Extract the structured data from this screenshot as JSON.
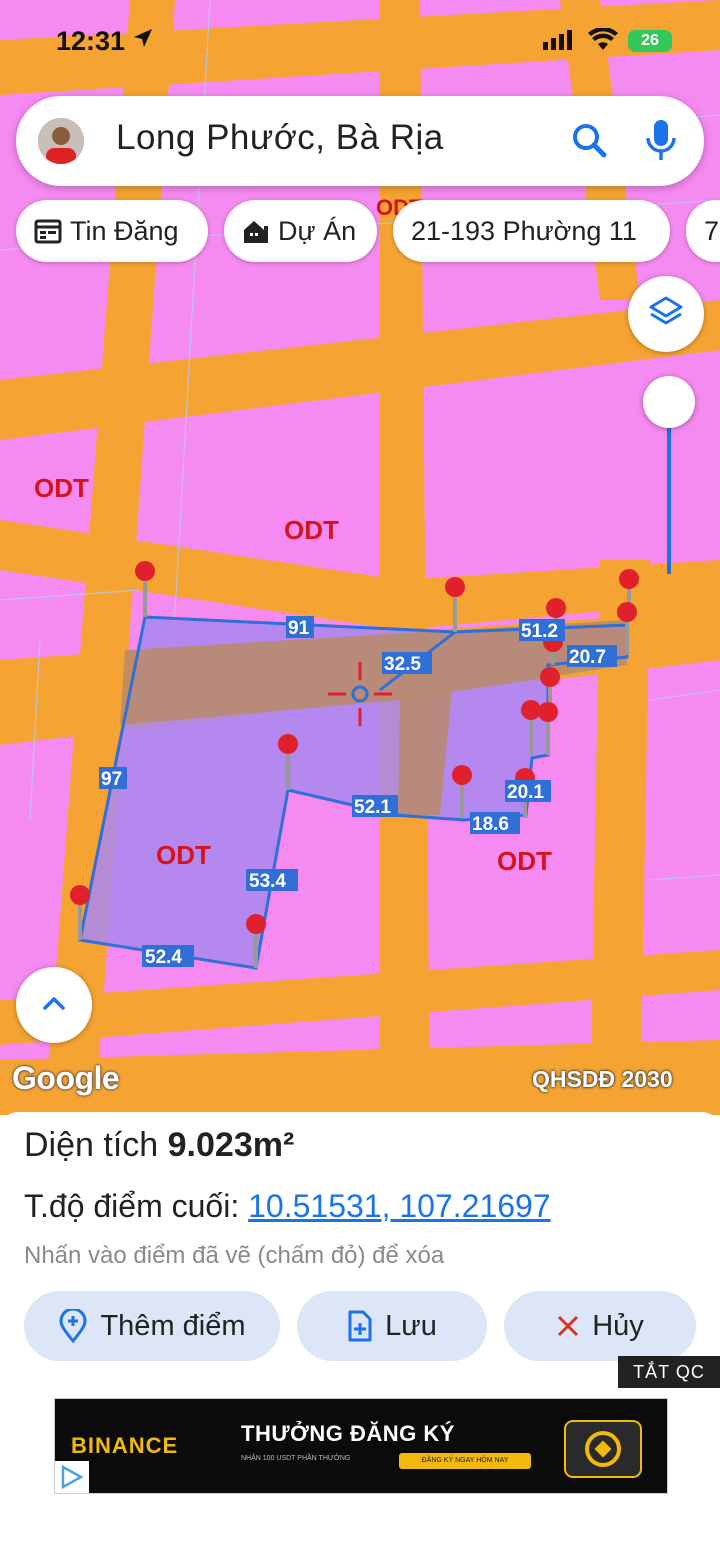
{
  "status_bar": {
    "time": "12:31",
    "battery": "26"
  },
  "search": {
    "query": "Long Phước, Bà Rịa"
  },
  "chips": [
    {
      "label": "Tin Đăng",
      "icon": "calendar-icon"
    },
    {
      "label": "Dự Án",
      "icon": "building-icon"
    },
    {
      "label": "21-193 Phường 11",
      "icon": ""
    },
    {
      "label": "7",
      "icon": ""
    }
  ],
  "map": {
    "zone_labels": [
      "ODT",
      "ODT",
      "ODT",
      "ODT",
      "ODT"
    ],
    "measurements": [
      "91",
      "51.2",
      "32.5",
      "20.7",
      "97",
      "52.1",
      "18.6",
      "20.1",
      "53.4",
      "52.4"
    ],
    "watermark": "Google",
    "layer_name": "QHSDĐ 2030",
    "colors": {
      "land": "#f58af0",
      "road": "#f5a433",
      "polygon": "#a987f0",
      "edge": "#2f6fd6",
      "pin": "#e0202a",
      "zone_label": "#d4141c"
    }
  },
  "panel": {
    "area_label": "Diện tích",
    "area_value": "9.023m²",
    "coord_label": "T.độ điểm cuối:",
    "coord_value": "10.51531, 107.21697",
    "hint": "Nhấn vào điểm đã vẽ (chấm đỏ) để xóa",
    "actions": [
      {
        "label": "Thêm điểm",
        "icon": "add-location-icon"
      },
      {
        "label": "Lưu",
        "icon": "save-file-icon"
      },
      {
        "label": "Hủy",
        "icon": "close-icon"
      }
    ]
  },
  "ad": {
    "tag": "TẮT QC",
    "brand": "BINANCE",
    "headline": "THƯỞNG ĐĂNG KÝ",
    "subtext": "NHẬN 100 USDT PHẦN THƯỞNG",
    "cta": "ĐĂNG KÝ NGAY HÔM NAY"
  }
}
